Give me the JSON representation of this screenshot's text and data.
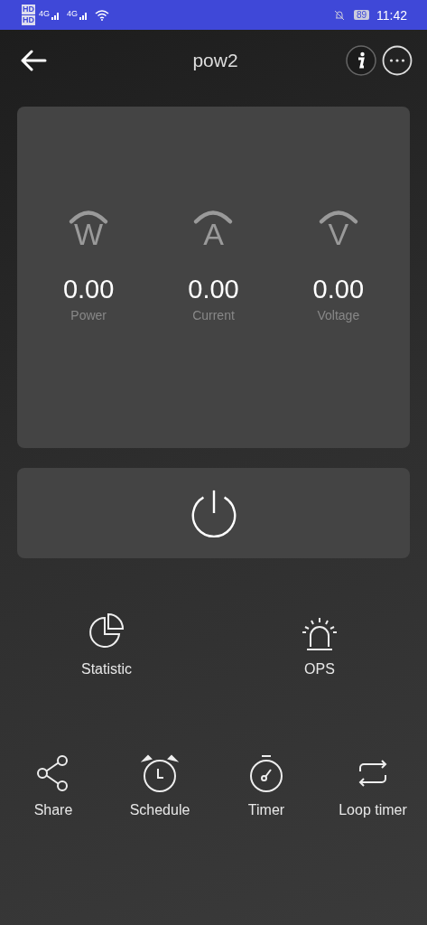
{
  "status_bar": {
    "network": [
      "4G",
      "4G"
    ],
    "sim_badges": [
      "HD",
      "HD"
    ],
    "battery": "89",
    "time": "11:42"
  },
  "header": {
    "title": "pow2"
  },
  "meters": [
    {
      "unit": "W",
      "value": "0.00",
      "label": "Power"
    },
    {
      "unit": "A",
      "value": "0.00",
      "label": "Current"
    },
    {
      "unit": "V",
      "value": "0.00",
      "label": "Voltage"
    }
  ],
  "features": [
    {
      "kind": "statistic",
      "label": "Statistic"
    },
    {
      "kind": "ops",
      "label": "OPS"
    }
  ],
  "actions": [
    {
      "kind": "share",
      "label": "Share"
    },
    {
      "kind": "schedule",
      "label": "Schedule"
    },
    {
      "kind": "timer",
      "label": "Timer"
    },
    {
      "kind": "loop",
      "label": "Loop timer"
    }
  ]
}
